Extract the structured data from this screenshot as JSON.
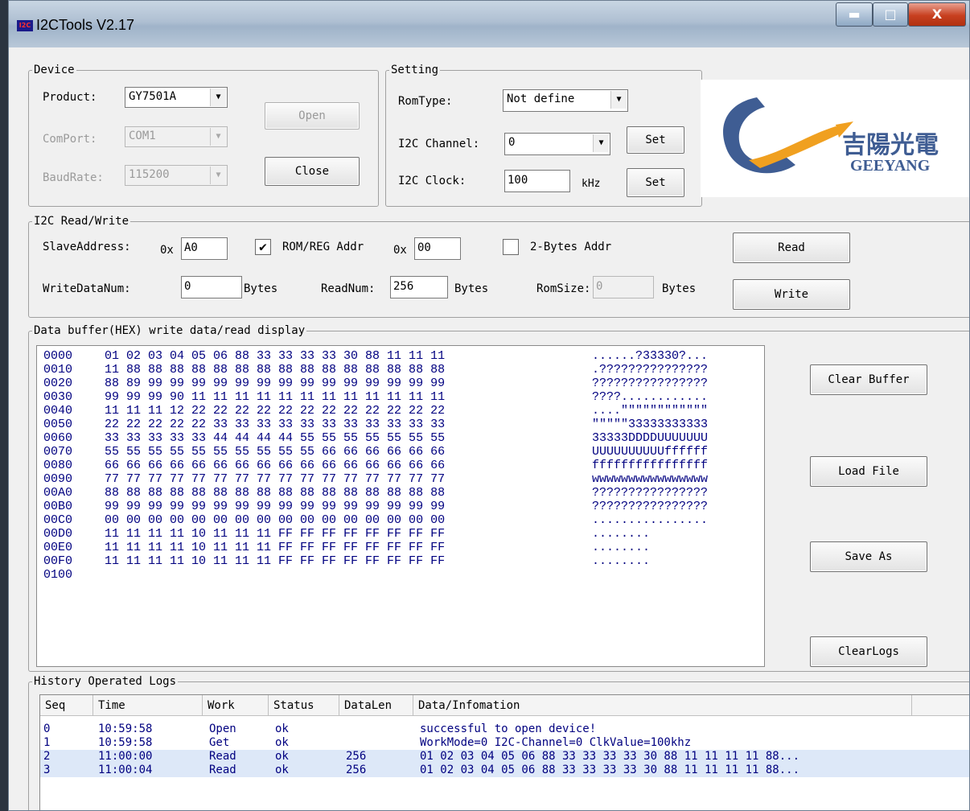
{
  "window": {
    "title": "I2CTools V2.17",
    "icon": "i2c-app-icon",
    "close": "X",
    "app_icon_text": "I2C"
  },
  "device": {
    "legend": "Device",
    "product_label": "Product:",
    "product_value": "GY7501A",
    "comport_label": "ComPort:",
    "comport_value": "COM1",
    "baudrate_label": "BaudRate:",
    "baudrate_value": "115200",
    "open_label": "Open",
    "close_label": "Close"
  },
  "setting": {
    "legend": "Setting",
    "romtype_label": "RomType:",
    "romtype_value": "Not define",
    "channel_label": "I2C Channel:",
    "channel_value": "0",
    "clock_label": "I2C Clock:",
    "clock_value": "100",
    "clock_unit": "kHz",
    "set_label": "Set"
  },
  "logo": {
    "cn": "吉陽光電",
    "en": "GEEYANG"
  },
  "rw": {
    "legend": "I2C Read/Write",
    "slave_label": "SlaveAddress:",
    "prefix": "0x",
    "slave_value": "A0",
    "romreg_label": "ROM/REG Addr",
    "romreg_checked": true,
    "romreg_value": "00",
    "twobytes_label": "2-Bytes Addr",
    "read_label": "Read",
    "write_label": "Write",
    "writenum_label": "WriteDataNum:",
    "writenum_value": "0",
    "bytes": "Bytes",
    "readnum_label": "ReadNum:",
    "readnum_value": "256",
    "romsize_label": "RomSize:",
    "romsize_value": "0"
  },
  "buffer": {
    "legend": "Data buffer(HEX) write data/read display",
    "clear_label": "Clear Buffer",
    "load_label": "Load File",
    "saveas_label": "Save As",
    "clearlogs_label": "ClearLogs",
    "rows": [
      {
        "addr": "0000",
        "bytes": "01 02 03 04 05 06 88 33 33 33 33 30 88 11 11 11",
        "ascii": "......?33330?..."
      },
      {
        "addr": "0010",
        "bytes": "11 88 88 88 88 88 88 88 88 88 88 88 88 88 88 88",
        "ascii": ".???????????????"
      },
      {
        "addr": "0020",
        "bytes": "88 89 99 99 99 99 99 99 99 99 99 99 99 99 99 99",
        "ascii": "????????????????"
      },
      {
        "addr": "0030",
        "bytes": "99 99 99 90 11 11 11 11 11 11 11 11 11 11 11 11",
        "ascii": "????............"
      },
      {
        "addr": "0040",
        "bytes": "11 11 11 12 22 22 22 22 22 22 22 22 22 22 22 22",
        "ascii": "....\"\"\"\"\"\"\"\"\"\"\"\""
      },
      {
        "addr": "0050",
        "bytes": "22 22 22 22 22 33 33 33 33 33 33 33 33 33 33 33",
        "ascii": "\"\"\"\"\"33333333333"
      },
      {
        "addr": "0060",
        "bytes": "33 33 33 33 33 44 44 44 44 55 55 55 55 55 55 55",
        "ascii": "33333DDDDUUUUUUU"
      },
      {
        "addr": "0070",
        "bytes": "55 55 55 55 55 55 55 55 55 55 66 66 66 66 66 66",
        "ascii": "UUUUUUUUUUffffff"
      },
      {
        "addr": "0080",
        "bytes": "66 66 66 66 66 66 66 66 66 66 66 66 66 66 66 66",
        "ascii": "ffffffffffffffff"
      },
      {
        "addr": "0090",
        "bytes": "77 77 77 77 77 77 77 77 77 77 77 77 77 77 77 77",
        "ascii": "wwwwwwwwwwwwwwww"
      },
      {
        "addr": "00A0",
        "bytes": "88 88 88 88 88 88 88 88 88 88 88 88 88 88 88 88",
        "ascii": "????????????????"
      },
      {
        "addr": "00B0",
        "bytes": "99 99 99 99 99 99 99 99 99 99 99 99 99 99 99 99",
        "ascii": "????????????????"
      },
      {
        "addr": "00C0",
        "bytes": "00 00 00 00 00 00 00 00 00 00 00 00 00 00 00 00",
        "ascii": "................"
      },
      {
        "addr": "00D0",
        "bytes": "11 11 11 11 10 11 11 11 FF FF FF FF FF FF FF FF",
        "ascii": "........"
      },
      {
        "addr": "00E0",
        "bytes": "11 11 11 11 10 11 11 11 FF FF FF FF FF FF FF FF",
        "ascii": "........"
      },
      {
        "addr": "00F0",
        "bytes": "11 11 11 11 10 11 11 11 FF FF FF FF FF FF FF FF",
        "ascii": "........"
      },
      {
        "addr": "0100",
        "bytes": "",
        "ascii": ""
      }
    ]
  },
  "logs": {
    "legend": "History Operated Logs",
    "columns": [
      "Seq",
      "Time",
      "Work",
      "Status",
      "DataLen",
      "Data/Infomation"
    ],
    "rows": [
      {
        "seq": "0",
        "time": "10:59:58",
        "work": "Open",
        "status": "ok",
        "len": "",
        "info": "successful to open device!"
      },
      {
        "seq": "1",
        "time": "10:59:58",
        "work": "Get",
        "status": "ok",
        "len": "",
        "info": "WorkMode=0 I2C-Channel=0 ClkValue=100khz"
      },
      {
        "seq": "2",
        "time": "11:00:00",
        "work": "Read",
        "status": "ok",
        "len": "256",
        "info": "01 02 03 04 05 06 88 33 33 33 33 30 88 11 11 11 11 88..."
      },
      {
        "seq": "3",
        "time": "11:00:04",
        "work": "Read",
        "status": "ok",
        "len": "256",
        "info": "01 02 03 04 05 06 88 33 33 33 33 30 88 11 11 11 11 88..."
      }
    ]
  }
}
